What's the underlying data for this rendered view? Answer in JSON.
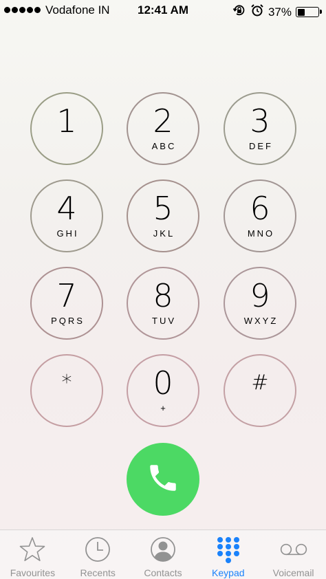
{
  "status_bar": {
    "carrier": "Vodafone IN",
    "time": "12:41 AM",
    "battery_percent": "37%",
    "battery_level": 0.37
  },
  "keypad": {
    "keys": [
      {
        "digit": "1",
        "letters": ""
      },
      {
        "digit": "2",
        "letters": "ABC"
      },
      {
        "digit": "3",
        "letters": "DEF"
      },
      {
        "digit": "4",
        "letters": "GHI"
      },
      {
        "digit": "5",
        "letters": "JKL"
      },
      {
        "digit": "6",
        "letters": "MNO"
      },
      {
        "digit": "7",
        "letters": "PQRS"
      },
      {
        "digit": "8",
        "letters": "TUV"
      },
      {
        "digit": "9",
        "letters": "WXYZ"
      },
      {
        "digit": "*",
        "letters": ""
      },
      {
        "digit": "0",
        "letters": "+"
      },
      {
        "digit": "#",
        "letters": ""
      }
    ]
  },
  "tabs": [
    {
      "label": "Favourites",
      "icon": "star-icon",
      "active": false
    },
    {
      "label": "Recents",
      "icon": "clock-icon",
      "active": false
    },
    {
      "label": "Contacts",
      "icon": "contact-icon",
      "active": false
    },
    {
      "label": "Keypad",
      "icon": "keypad-icon",
      "active": true
    },
    {
      "label": "Voicemail",
      "icon": "voicemail-icon",
      "active": false
    }
  ],
  "colors": {
    "call_green": "#4cd964",
    "active_tab": "#1a82fb",
    "inactive_tab": "#929292"
  }
}
